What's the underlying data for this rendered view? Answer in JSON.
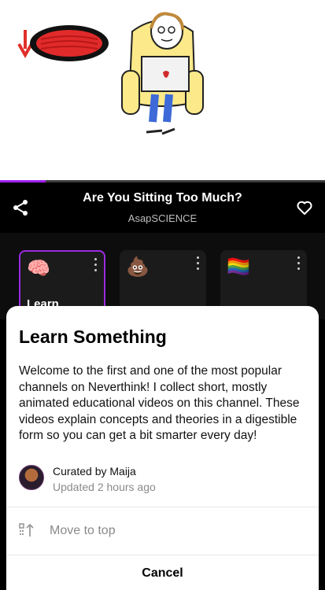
{
  "player": {
    "progress": 0.14,
    "title": "Are You Sitting Too Much?",
    "channel": "AsapSCIENCE"
  },
  "channels": [
    {
      "emoji": "🧠",
      "label": "Learn",
      "selected": true
    },
    {
      "emoji": "💩",
      "label": "",
      "selected": false
    },
    {
      "emoji": "🏳️‍🌈",
      "label": "",
      "selected": false
    }
  ],
  "sheet": {
    "title": "Learn Something",
    "description": "Welcome to the first and one of the most popular channels on Neverthink! I collect short, mostly animated educational videos on this channel. These videos explain concepts and theories in a digestible form so you can get a bit smarter every day!",
    "curated_by": "Curated by Maija",
    "updated": "Updated 2 hours ago",
    "move_to_top": "Move to top",
    "cancel": "Cancel"
  },
  "colors": {
    "accent": "#9b2be0",
    "progress": "#a020f0"
  },
  "icons": [
    "share-icon",
    "heart-icon",
    "more-vertical-icon",
    "move-to-top-icon"
  ]
}
